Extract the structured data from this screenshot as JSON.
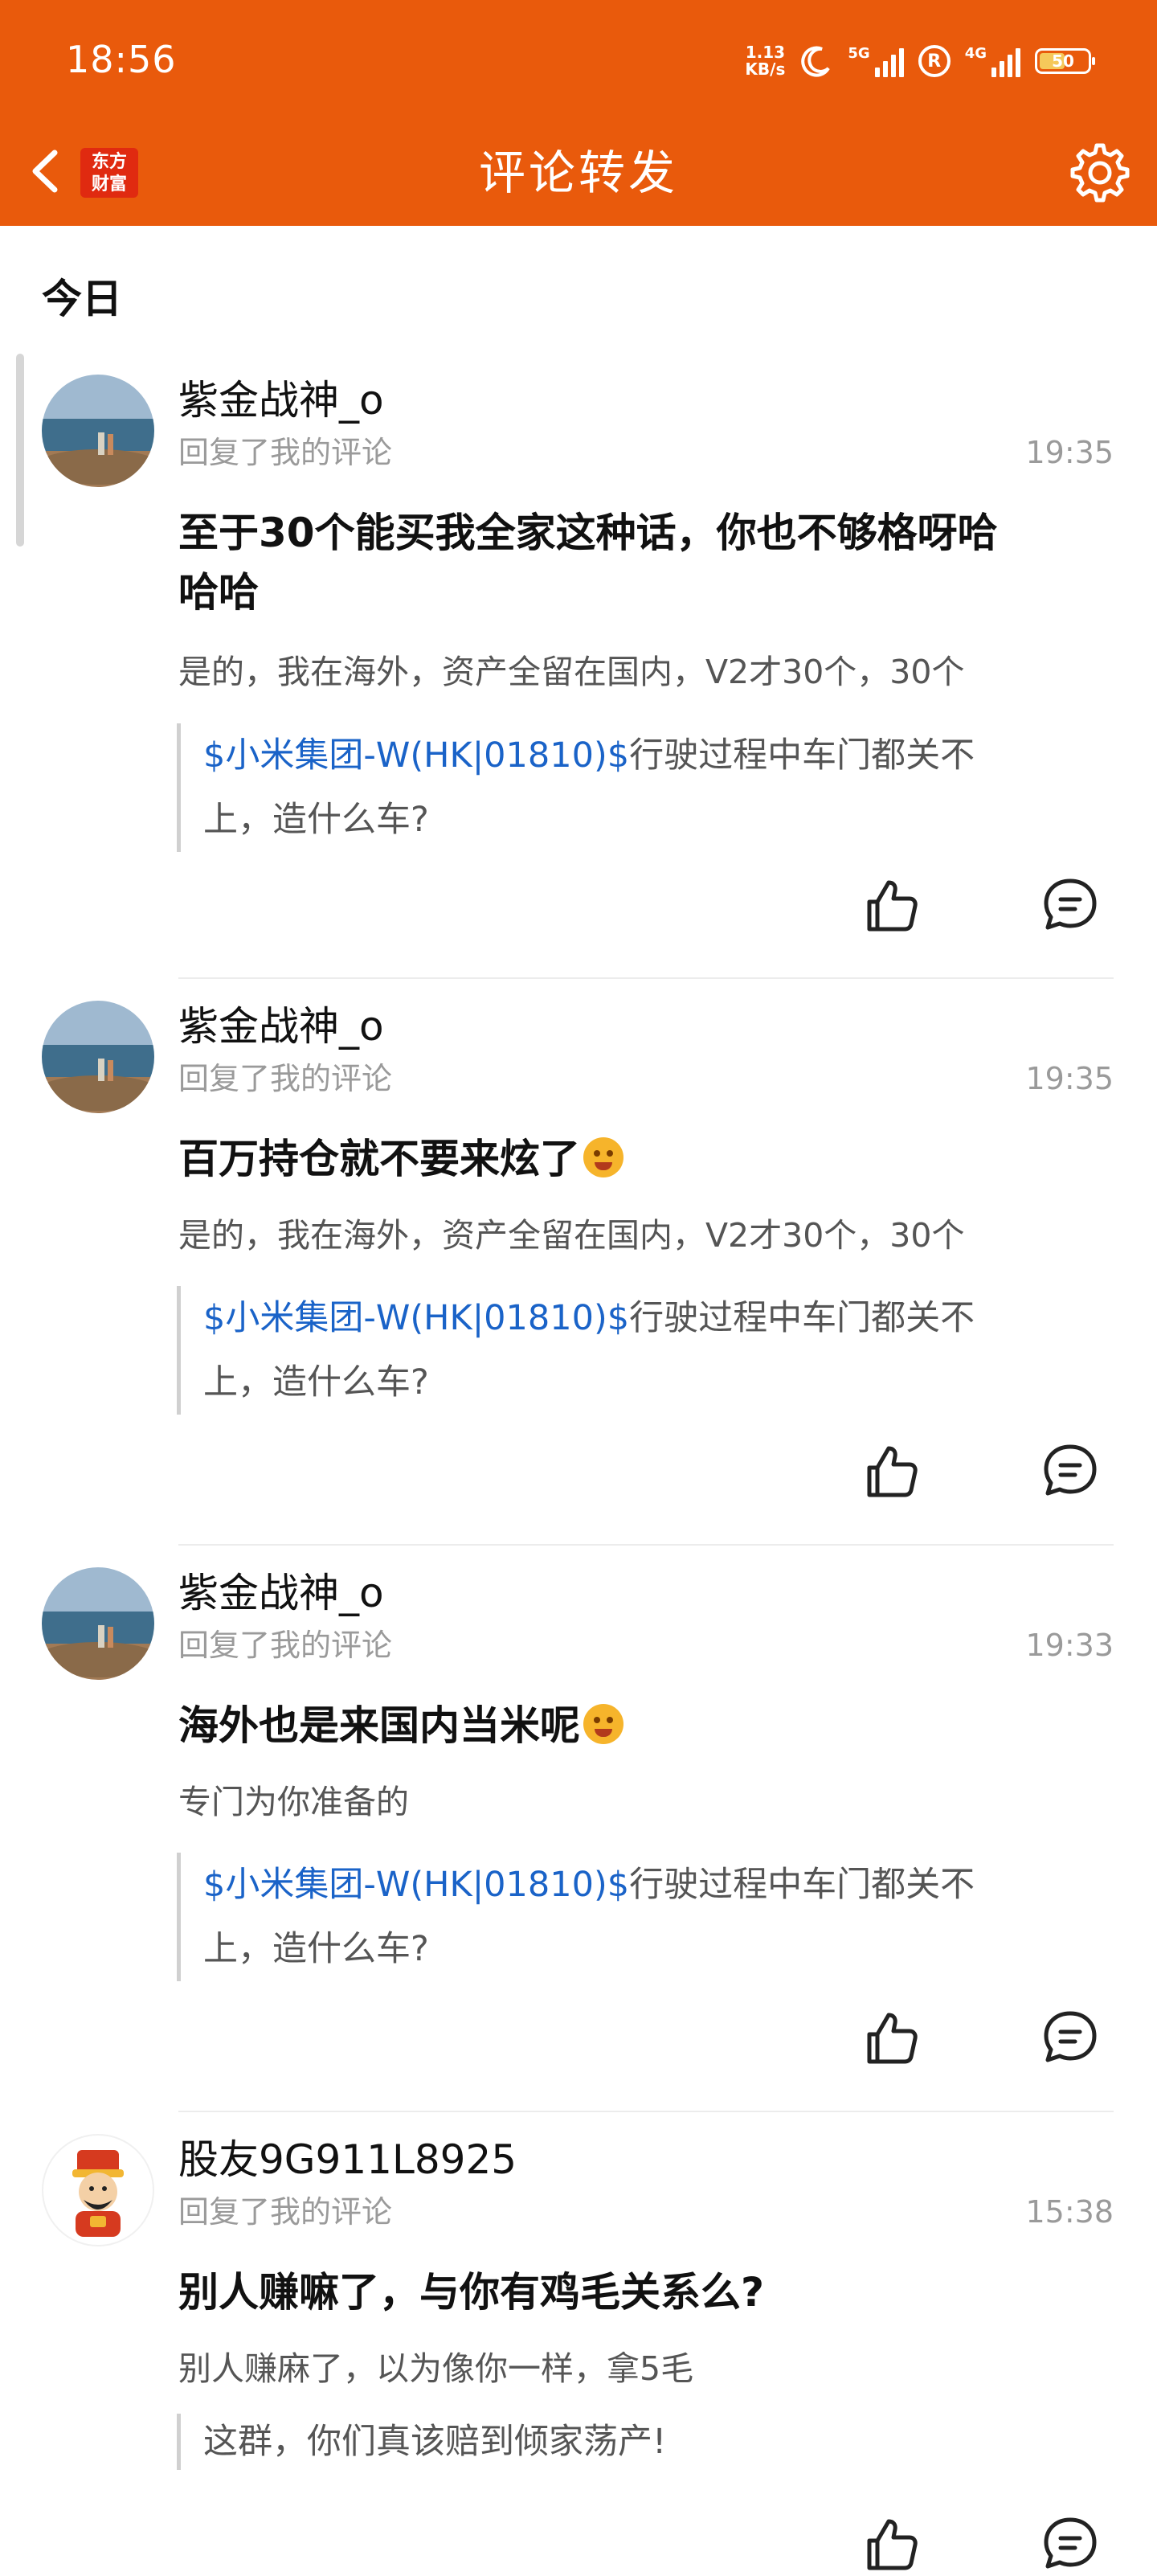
{
  "status_bar": {
    "time": "18:56",
    "net_speed_value": "1.13",
    "net_speed_unit": "KB/s",
    "sim1": "5G",
    "sim2": "4G",
    "roaming": "R",
    "battery": "50"
  },
  "nav": {
    "title": "评论转发",
    "brand_line1": "东方",
    "brand_line2": "财富"
  },
  "section": "今日",
  "items": [
    {
      "user": "紫金战神_o",
      "action": "回复了我的评论",
      "time": "19:35",
      "reply_line1": "至于30个能买我全家这种话，你也不够格呀哈",
      "reply_line2": "哈哈",
      "my_comment": "是的，我在海外，资产全留在国内，V2才30个，30个",
      "quote_stock": "$小米集团-W(HK|01810)$",
      "quote_line1": "行驶过程中车门都关不",
      "quote_line2": "上，造什么车?"
    },
    {
      "user": "紫金战神_o",
      "action": "回复了我的评论",
      "time": "19:35",
      "reply": "百万持仓就不要来炫了",
      "my_comment": "是的，我在海外，资产全留在国内，V2才30个，30个",
      "quote_stock": "$小米集团-W(HK|01810)$",
      "quote_line1": "行驶过程中车门都关不",
      "quote_line2": "上，造什么车?"
    },
    {
      "user": "紫金战神_o",
      "action": "回复了我的评论",
      "time": "19:33",
      "reply": "海外也是来国内当米呢",
      "my_comment": "专门为你准备的",
      "quote_stock": "$小米集团-W(HK|01810)$",
      "quote_line1": "行驶过程中车门都关不",
      "quote_line2": "上，造什么车?"
    },
    {
      "user": "股友9G911L8925",
      "action": "回复了我的评论",
      "time": "15:38",
      "reply": "别人赚嘛了，与你有鸡毛关系么?",
      "my_comment": "别人赚麻了，以为像你一样，拿5毛",
      "quote": "这群，你们真该赔到倾家荡产!"
    }
  ],
  "colors": {
    "header_bg": "#e95a0c",
    "stock_link": "#1a63c8",
    "muted_text": "#9a9a9a"
  },
  "icons": [
    "back-arrow-icon",
    "settings-gear-icon",
    "thumbs-up-icon",
    "comment-bubble-icon",
    "moon-icon"
  ]
}
